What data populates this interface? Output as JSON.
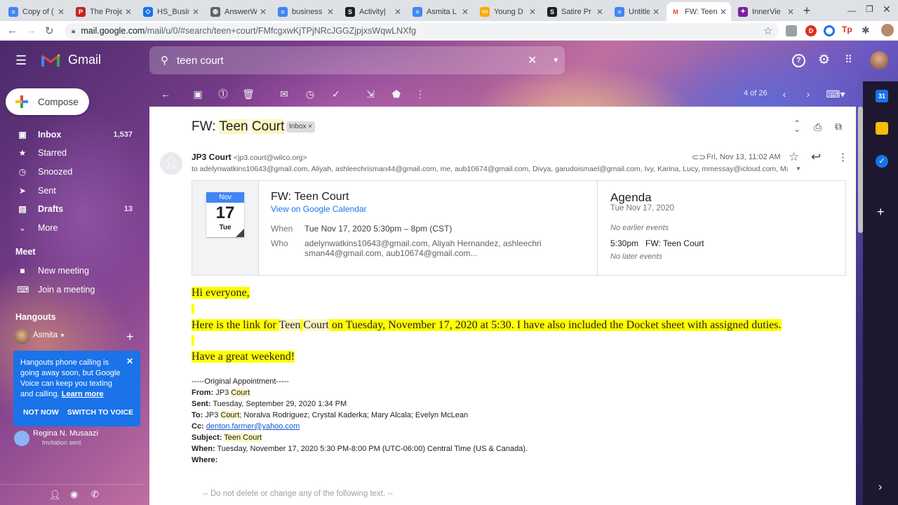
{
  "browser": {
    "tabs": [
      {
        "title": "Copy of (",
        "color": "#4285f4",
        "glyph": "≡"
      },
      {
        "title": "The Proje",
        "color": "#c5221f",
        "glyph": "P"
      },
      {
        "title": "HS_Busin",
        "color": "#1a73e8",
        "glyph": "◇"
      },
      {
        "title": "AnswerW",
        "color": "#5f6368",
        "glyph": "◍"
      },
      {
        "title": "business",
        "color": "#4285f4",
        "glyph": "≡"
      },
      {
        "title": "Activity|",
        "color": "#1f1f1f",
        "glyph": "S"
      },
      {
        "title": "Asmita L",
        "color": "#4285f4",
        "glyph": "≡"
      },
      {
        "title": "Young D",
        "color": "#f9ab00",
        "glyph": "▭"
      },
      {
        "title": "Satire Pr",
        "color": "#1f1f1f",
        "glyph": "S"
      },
      {
        "title": "Untitled",
        "color": "#4285f4",
        "glyph": "≡"
      },
      {
        "title": "FW: Teen",
        "color": "#ffffff",
        "glyph": "M",
        "active": true
      },
      {
        "title": "InnerVie",
        "color": "#7b1fa2",
        "glyph": "✦"
      }
    ],
    "url_domain": "mail.google.com",
    "url_path": "/mail/u/0/#search/teen+court/FMfcgxwKjTPjNRcJGGZjpjxsWqwLNXfg"
  },
  "gmail": {
    "product": "Gmail",
    "search": {
      "value": "teen court"
    },
    "compose_label": "Compose",
    "nav": [
      {
        "label": "Inbox",
        "icon": "inbox-icon",
        "glyph": "▣",
        "count": "1,537",
        "bold": true
      },
      {
        "label": "Starred",
        "icon": "star-icon",
        "glyph": "★",
        "count": ""
      },
      {
        "label": "Snoozed",
        "icon": "clock-icon",
        "glyph": "◷",
        "count": ""
      },
      {
        "label": "Sent",
        "icon": "send-icon",
        "glyph": "➤",
        "count": ""
      },
      {
        "label": "Drafts",
        "icon": "draft-icon",
        "glyph": "▤",
        "count": "13",
        "bold": true
      },
      {
        "label": "More",
        "icon": "chevron-down-icon",
        "glyph": "⌄",
        "count": ""
      }
    ],
    "meet": {
      "heading": "Meet",
      "new_meeting": "New meeting",
      "join_meeting": "Join a meeting"
    },
    "hangouts": {
      "heading": "Hangouts",
      "user": "Asmita",
      "popup_text": "Hangouts phone calling is going away soon, but Google Voice can keep you texting and calling.",
      "popup_link": "Learn more",
      "popup_not_now": "NOT NOW",
      "popup_switch": "SWITCH TO VOICE",
      "contact_name": "Regina N. Musaazi",
      "contact_status": "Invitation sent"
    },
    "pager": "4 of 26"
  },
  "message": {
    "subject_prefix": "FW: ",
    "subject_teen": "Teen",
    "subject_court": "Court",
    "label": "Inbox",
    "sender_name": "JP3 Court",
    "sender_email": "<jp3.court@wilco.org>",
    "date": "Fri, Nov 13, 11:02 AM",
    "to_line": "to adelynwatkins10643@gmail.com, Aliyah, ashleechrisman44@gmail.com, me, aub10674@gmail.com, Divya, garudoismael@gmail.com, Ivy, Karina, Lucy, mmessay@icloud.com, Mallik",
    "calendar": {
      "month": "Nov",
      "day": "17",
      "weekday": "Tue",
      "title": "FW: Teen Court",
      "view_link": "View on Google Calendar",
      "when_label": "When",
      "when_value": "Tue Nov 17, 2020 5:30pm – 8pm (CST)",
      "who_label": "Who",
      "who_value": "adelynwatkins10643@gmail.com, Aliyah Hernandez, ashleechrisman44@gmail.com, aub10674@gmail.com...",
      "agenda_title": "Agenda",
      "agenda_date": "Tue Nov 17, 2020",
      "no_earlier": "No earlier events",
      "event_time": "5:30pm",
      "event_title": "FW: Teen Court",
      "no_later": "No later events"
    },
    "body": {
      "greeting": "Hi everyone,",
      "line2_pre": "Here is the link for ",
      "line2_teen": "Teen",
      "line2_court": "Court",
      "line2_post": " on Tuesday, November 17, 2020 at 5:30. I have also included the Docket sheet with assigned duties.",
      "closing": "Have a great weekend!"
    },
    "original": {
      "header": "-----Original Appointment-----",
      "from_label": "From:",
      "from_value": "JP3 ",
      "from_court": "Court",
      "sent_label": "Sent:",
      "sent_value": "Tuesday, September 29, 2020 1:34 PM",
      "to_label": "To:",
      "to_pre": "JP3 ",
      "to_court": "Court",
      "to_rest": "; Noralva Rodriguez; Crystal Kaderka; Mary Alcala; Evelyn McLean",
      "cc_label": "Cc:",
      "cc_value": "denton.farmer@yahoo.com",
      "subject_label": "Subject:",
      "subject_value": "Teen Court",
      "when_label": "When:",
      "when_value": "Tuesday, November 17, 2020 5:30 PM-8:00 PM (UTC-06:00) Central Time (US & Canada).",
      "where_label": "Where:"
    },
    "footer_note": "-- Do not delete or change any of the following text. --"
  }
}
